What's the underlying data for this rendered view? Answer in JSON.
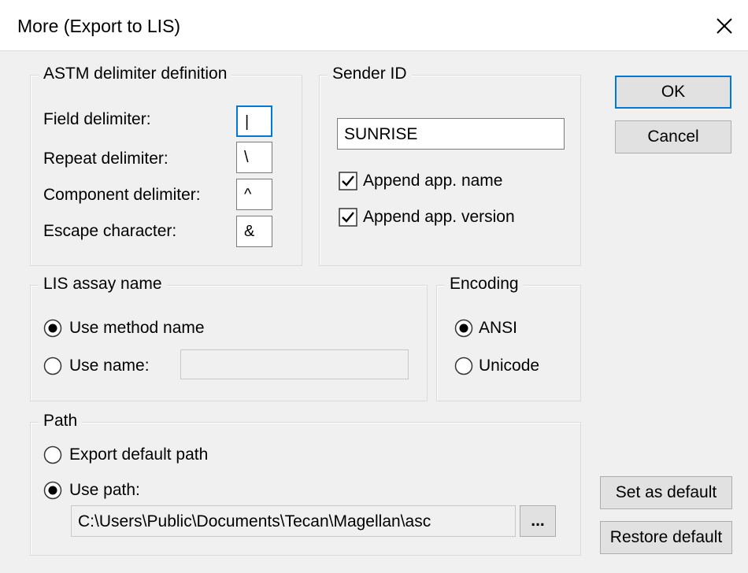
{
  "window": {
    "title": "More (Export to LIS)"
  },
  "astm": {
    "legend": "ASTM delimiter definition",
    "field_label": "Field delimiter:",
    "field_value": "|",
    "repeat_label": "Repeat delimiter:",
    "repeat_value": "\\",
    "component_label": "Component delimiter:",
    "component_value": "^",
    "escape_label": "Escape character:",
    "escape_value": "&"
  },
  "sender": {
    "legend": "Sender ID",
    "value": "SUNRISE",
    "append_name_label": "Append app. name",
    "append_name_checked": true,
    "append_version_label": "Append app. version",
    "append_version_checked": true
  },
  "assay": {
    "legend": "LIS assay name",
    "use_method_label": "Use method name",
    "use_name_label": "Use name:",
    "use_name_value": "",
    "selected": "use_method"
  },
  "encoding": {
    "legend": "Encoding",
    "ansi_label": "ANSI",
    "unicode_label": "Unicode",
    "selected": "ansi"
  },
  "path": {
    "legend": "Path",
    "export_default_label": "Export default path",
    "use_path_label": "Use path:",
    "value": "C:\\Users\\Public\\Documents\\Tecan\\Magellan\\asc",
    "browse_label": "...",
    "selected": "use_path"
  },
  "buttons": {
    "ok": "OK",
    "cancel": "Cancel",
    "set_default": "Set as default",
    "restore_default": "Restore default"
  },
  "icons": {
    "close": "close-icon",
    "checkbox": "checkbox-checked-icon",
    "radio": "radio-button-icon"
  },
  "colors": {
    "accent": "#0078d7",
    "window_bg": "#f0f0f0",
    "border": "#adadad"
  }
}
